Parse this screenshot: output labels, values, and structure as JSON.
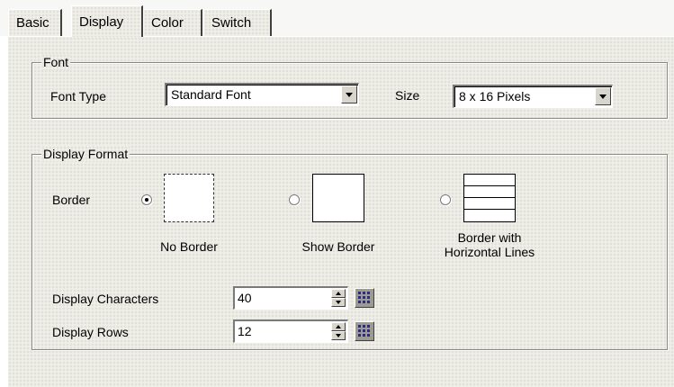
{
  "tabs": [
    "Basic",
    "Display",
    "Color",
    "Switch"
  ],
  "active_tab": "Display",
  "font_group": {
    "title": "Font",
    "font_type_label": "Font Type",
    "font_type_value": "Standard Font",
    "size_label": "Size",
    "size_value": "8 x 16 Pixels"
  },
  "display_format": {
    "title": "Display Format",
    "border_label": "Border",
    "options": [
      "No Border",
      "Show Border",
      "Border with\nHorizontal Lines"
    ],
    "selected_option": "No Border",
    "display_characters_label": "Display Characters",
    "display_characters_value": "40",
    "display_rows_label": "Display Rows",
    "display_rows_value": "12"
  },
  "icons": {
    "dropdown": "chevron-down-icon",
    "spin": "spin-up-down-icon",
    "keypad": "keypad-icon"
  }
}
